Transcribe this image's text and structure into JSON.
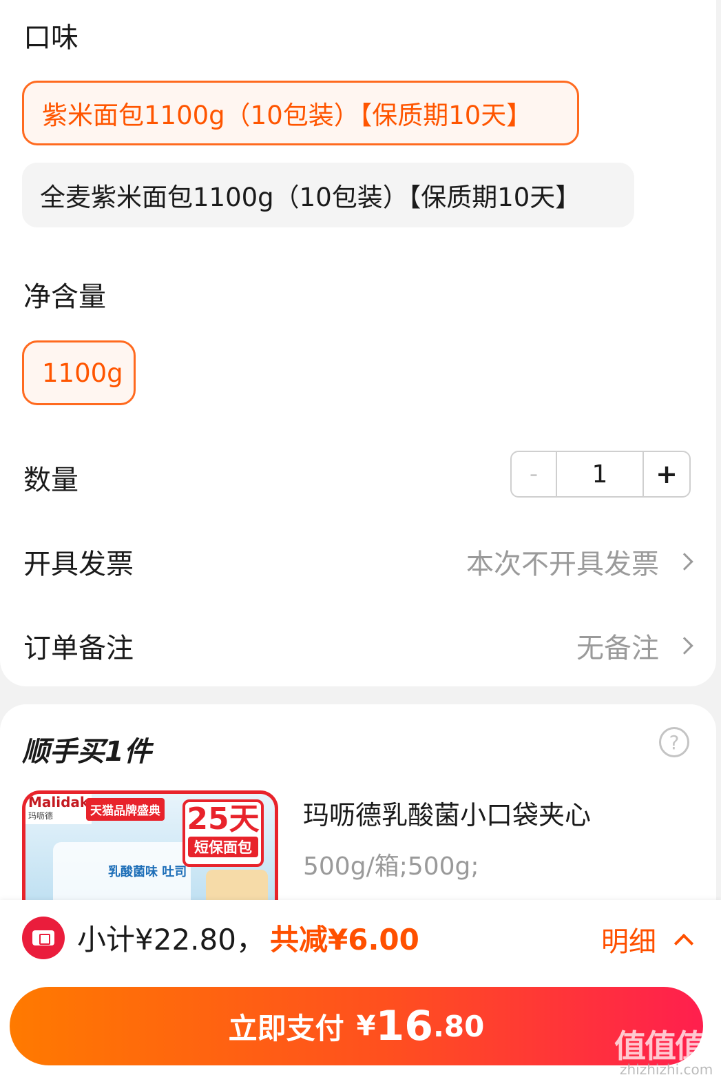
{
  "flavor": {
    "label": "口味",
    "options": [
      {
        "label": "紫米面包1100g（10包装）【保质期10天】",
        "selected": true
      },
      {
        "label": "全麦紫米面包1100g（10包装）【保质期10天】",
        "selected": false
      }
    ]
  },
  "net_content": {
    "label": "净含量",
    "options": [
      {
        "label": "1100g",
        "selected": true
      }
    ]
  },
  "quantity": {
    "label": "数量",
    "minus": "-",
    "value": "1",
    "plus": "+"
  },
  "invoice": {
    "label": "开具发票",
    "value": "本次不开具发票"
  },
  "remark": {
    "label": "订单备注",
    "value": "无备注"
  },
  "addon": {
    "title": "顺手买1件",
    "help_icon": "?",
    "product": {
      "name": "玛呖德乳酸菌小口袋夹心",
      "spec": "500g/箱;500g;",
      "image": {
        "brand": "Malidak",
        "brand_cn": "玛呖德",
        "banner": "天猫品牌盛典",
        "badge_big": "25天",
        "badge_small": "短保面包",
        "pack_text": "乳酸菌味 吐司"
      }
    }
  },
  "summary": {
    "subtotal": "小计¥22.80，",
    "discount": "共减¥6.00",
    "detail": "明细"
  },
  "pay": {
    "label": "立即支付",
    "currency": "¥",
    "amount_int": "16",
    "amount_dec": ".80"
  },
  "watermark": {
    "main": "值值值",
    "sub": "zhizhizhi.com"
  },
  "colors": {
    "accent": "#ff5500",
    "brand_red": "#e8232b",
    "muted": "#9a9a9a"
  }
}
